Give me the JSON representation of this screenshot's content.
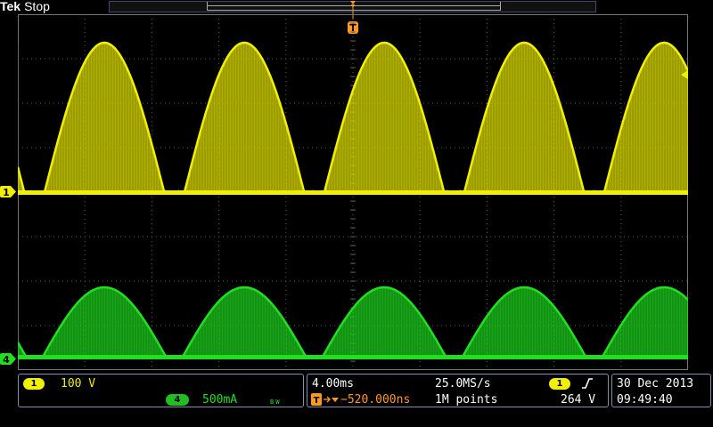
{
  "header": {
    "brand": "Tek",
    "acq_status": "Stop"
  },
  "channels": {
    "ch1": {
      "number": "1",
      "scale": "100 V",
      "color": "#f0f000"
    },
    "ch4": {
      "number": "4",
      "scale": "500mA",
      "bw_symbol": "B W",
      "color": "#20e020"
    }
  },
  "horizontal": {
    "time_per_div": "4.00ms",
    "sample_rate": "25.0MS/s",
    "trigger_position": "−520.000ns",
    "record_length": "1M points"
  },
  "trigger": {
    "source": "1",
    "slope_icon": "rising-edge-icon",
    "level": "264 V",
    "marker_letter": "T",
    "color": "#ff9a20"
  },
  "datetime": {
    "date": "30 Dec 2013",
    "time": "09:49:40"
  },
  "colors": {
    "grid": "#5a5a5a",
    "panel_border": "#7f8fb0"
  }
}
